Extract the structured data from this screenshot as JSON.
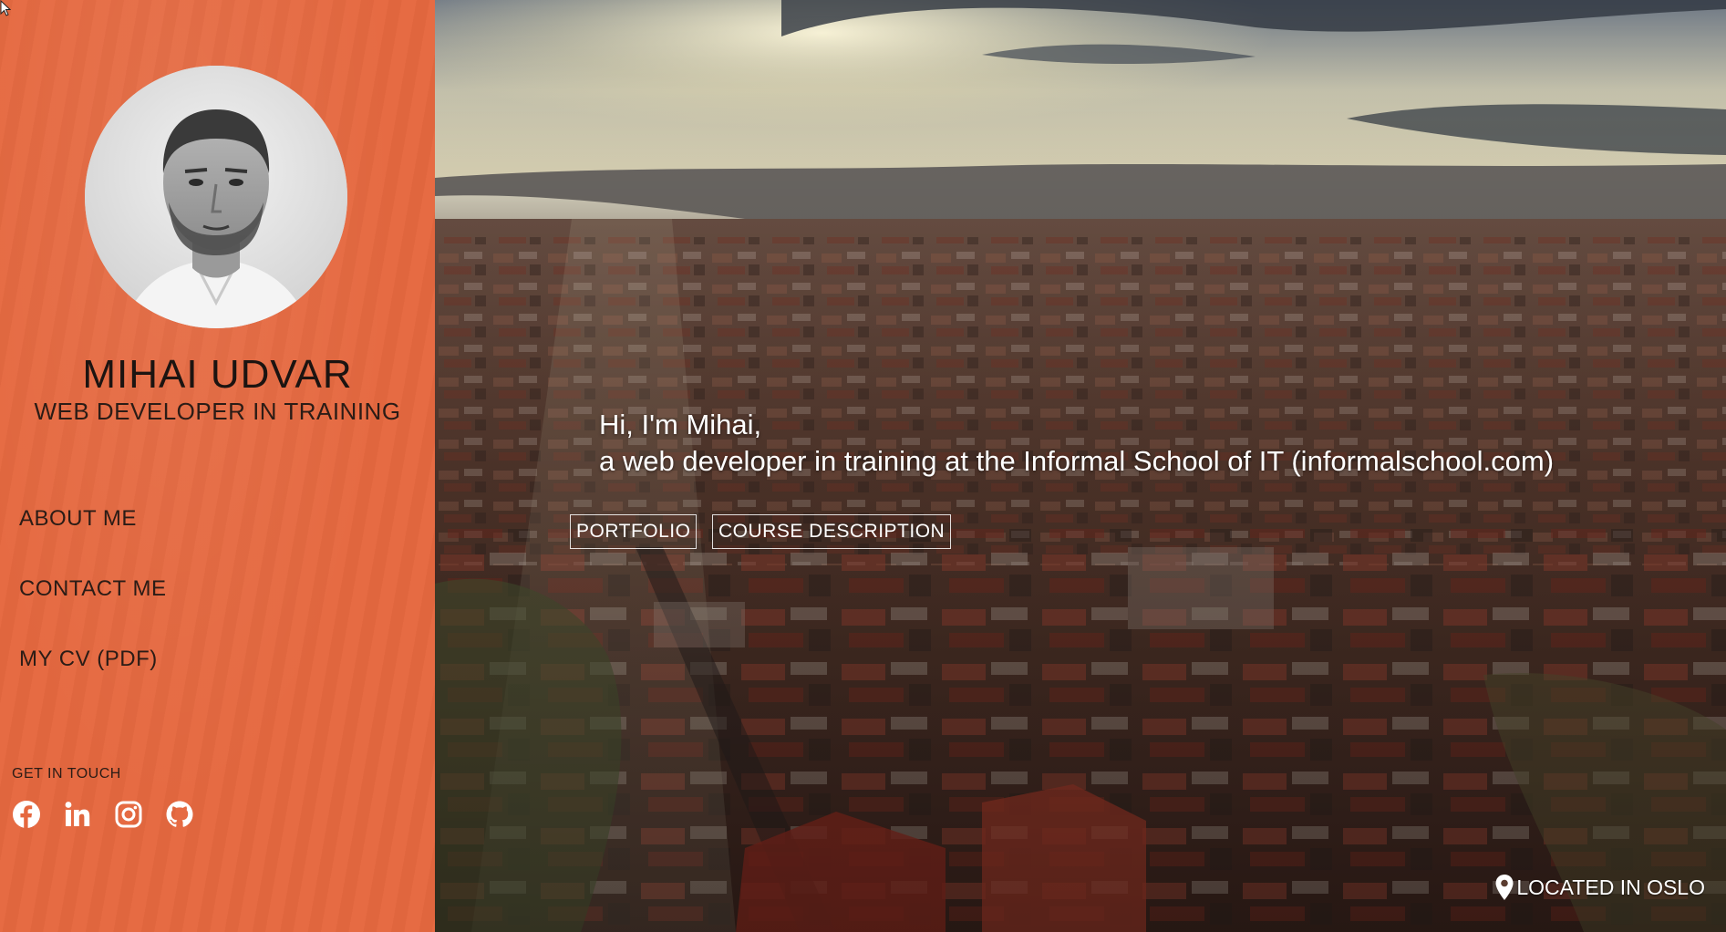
{
  "profile": {
    "name": "MIHAI UDVAR",
    "role": "WEB DEVELOPER IN TRAINING"
  },
  "nav": {
    "items": [
      {
        "label": "ABOUT ME"
      },
      {
        "label": "CONTACT ME"
      },
      {
        "label": "MY CV (PDF)"
      }
    ]
  },
  "social": {
    "label": "GET IN TOUCH",
    "icons": [
      "facebook-icon",
      "linkedin-icon",
      "instagram-icon",
      "github-icon"
    ]
  },
  "hero": {
    "greeting_line1": "Hi, I'm Mihai,",
    "greeting_line2": "a web developer in training at the Informal School of IT (informalschool.com)",
    "buttons": {
      "portfolio": "PORTFOLIO",
      "course": "COURSE DESCRIPTION"
    },
    "location": "LOCATED IN OSLO"
  },
  "colors": {
    "sidebar": "#e5683f",
    "text_dark": "#2b1c16",
    "hero_text": "#ffffff"
  }
}
